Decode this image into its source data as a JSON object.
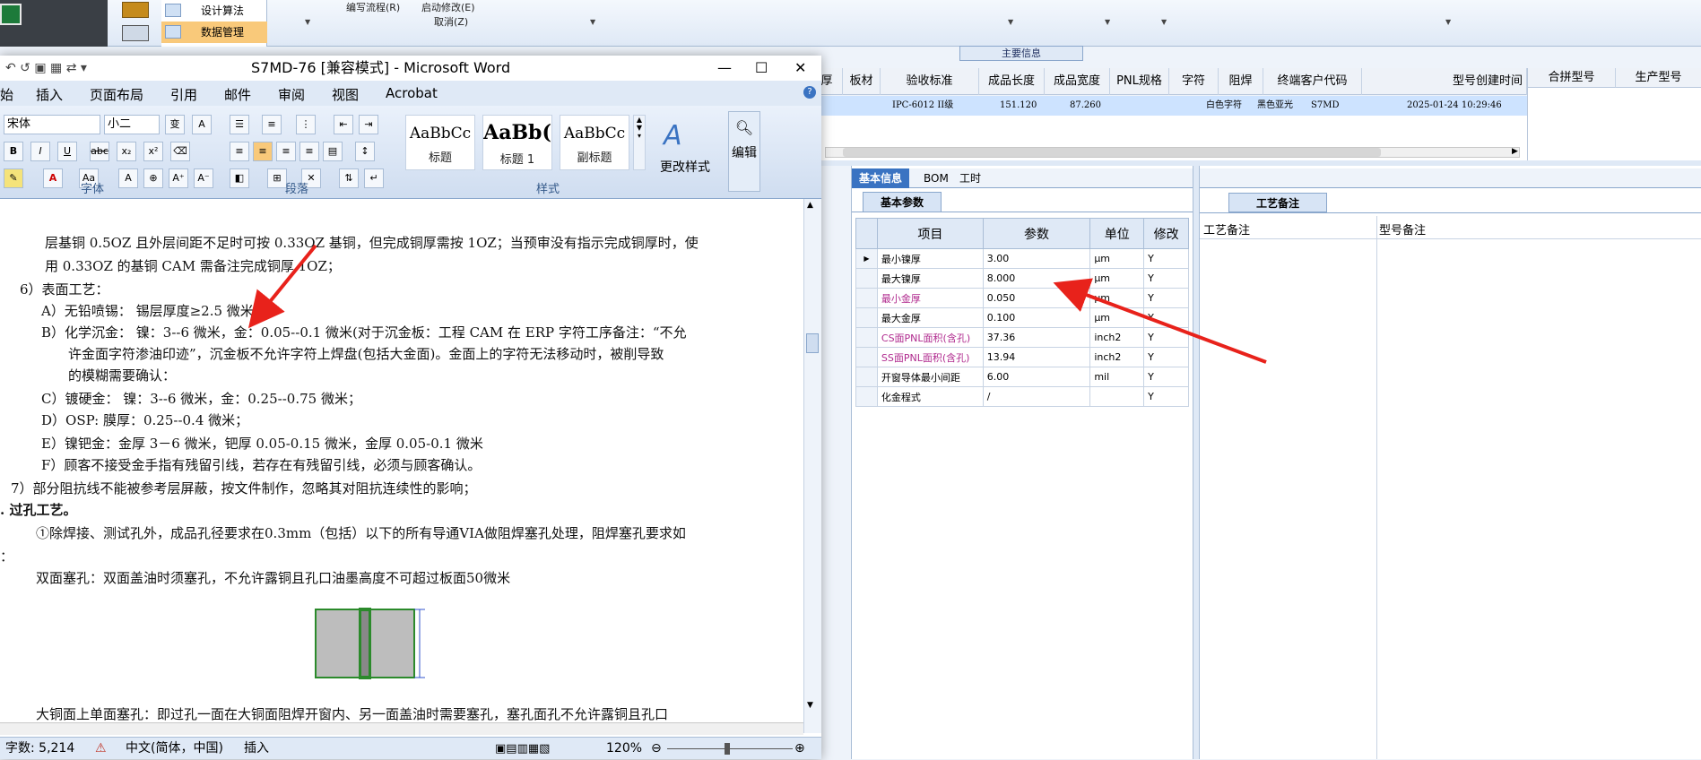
{
  "erp": {
    "nav": {
      "design_algo": "设计算法",
      "data_mgmt": "数据管理"
    },
    "menu": {
      "edit_flow": "编写流程(R)",
      "start_modify": "启动修改(E)",
      "cancel": "取消(Z)"
    },
    "info_title": "主要信息",
    "grid_headers": [
      "厚",
      "板材",
      "验收标准",
      "成品长度",
      "成品宽度",
      "PNL规格",
      "字符",
      "阻焊",
      "终端客户代码",
      "型号创建时间"
    ],
    "right_headers": [
      "合拼型号",
      "生产型号"
    ],
    "row": {
      "standard": "IPC-6012 II级",
      "length": "151.120",
      "width": "87.260",
      "char": "白色字符",
      "mask": "黑色亚光",
      "cust": "S7MD",
      "created": "2025-01-24 10:29:46"
    },
    "tabs": [
      "基本信息",
      "BOM",
      "工时"
    ],
    "sub_tab": "基本参数",
    "param_headers": [
      "项目",
      "参数",
      "单位",
      "修改"
    ],
    "params": [
      {
        "item": "最小镍厚",
        "value": "3.00",
        "unit": "μm",
        "mod": "Y",
        "pink": false
      },
      {
        "item": "最大镍厚",
        "value": "8.000",
        "unit": "μm",
        "mod": "Y",
        "pink": false
      },
      {
        "item": "最小金厚",
        "value": "0.050",
        "unit": "μm",
        "mod": "Y",
        "pink": true
      },
      {
        "item": "最大金厚",
        "value": "0.100",
        "unit": "μm",
        "mod": "Y",
        "pink": false
      },
      {
        "item": "CS面PNL面积(含孔)",
        "value": "37.36",
        "unit": "inch2",
        "mod": "Y",
        "pink": true
      },
      {
        "item": "SS面PNL面积(含孔)",
        "value": "13.94",
        "unit": "inch2",
        "mod": "Y",
        "pink": true
      },
      {
        "item": "开窗导体最小间距",
        "value": "6.00",
        "unit": "mil",
        "mod": "Y",
        "pink": false
      },
      {
        "item": "化金程式",
        "value": "/",
        "unit": "",
        "mod": "Y",
        "pink": false
      }
    ],
    "process_tab": "工艺备注",
    "process_headers": [
      "工艺备注",
      "型号备注"
    ]
  },
  "word": {
    "title": "S7MD-76 [兼容模式] - Microsoft Word",
    "tabs": [
      "始",
      "插入",
      "页面布局",
      "引用",
      "邮件",
      "审阅",
      "视图",
      "Acrobat"
    ],
    "font_name": "宋体",
    "font_size": "小二",
    "groups": {
      "font": "字体",
      "para": "段落",
      "styles": "样式"
    },
    "styles": [
      {
        "sample": "AaBbCc",
        "name": "标题"
      },
      {
        "sample": "AaBb(",
        "name": "标题 1"
      },
      {
        "sample": "AaBbCc",
        "name": "副标题"
      }
    ],
    "change_styles": "更改样式",
    "edit": "编辑",
    "doc_lines": [
      "层基铜 0.5OZ 且外层间距不足时可按 0.33OZ 基铜，但完成铜厚需按 1OZ；当预审没有指示完成铜厚时，使",
      "用 0.33OZ 的基铜 CAM 需备注完成铜厚 1OZ；",
      "6）表面工艺：",
      "A）无铅喷锡：  锡层厚度≥2.5 微米；",
      "B）化学沉金：  镍：3--6 微米，金：0.05--0.1 微米(对于沉金板：工程 CAM 在 ERP 字符工序备注：“不允",
      "许金面字符渗油印迹”，沉金板不允许字符上焊盘(包括大金面)。金面上的字符无法移动时，被削导致",
      "的模糊需要确认：",
      "C）镀硬金：    镍：3--6 微米，金：0.25--0.75 微米；",
      "D）OSP:        膜厚：0.25--0.4 微米；",
      "E）镍钯金：金厚 3－6 微米，钯厚 0.05-0.15 微米，金厚 0.05-0.1 微米",
      "F）顾客不接受金手指有残留引线，若存在有残留引线，必须与顾客确认。",
      "7）部分阻抗线不能被参考层屏蔽，按文件制作，忽略其对阻抗连续性的影响；",
      ".  过孔工艺。",
      "①除焊接、测试孔外，成品孔径要求在0.3mm（包括）以下的所有导通VIA做阻焊塞孔处理，阻焊塞孔要求如",
      "：",
      "双面塞孔：双面盖油时须塞孔，不允许露铜且孔口油墨高度不可超过板面50微米",
      "大铜面上单面塞孔：即过孔一面在大铜面阻焊开窗内、另一面盖油时需要塞孔，塞孔面孔不允许露铜且孔口"
    ],
    "status": {
      "words": "字数: 5,214",
      "lang": "中文(简体，中国)",
      "mode": "插入",
      "zoom": "120%"
    }
  }
}
